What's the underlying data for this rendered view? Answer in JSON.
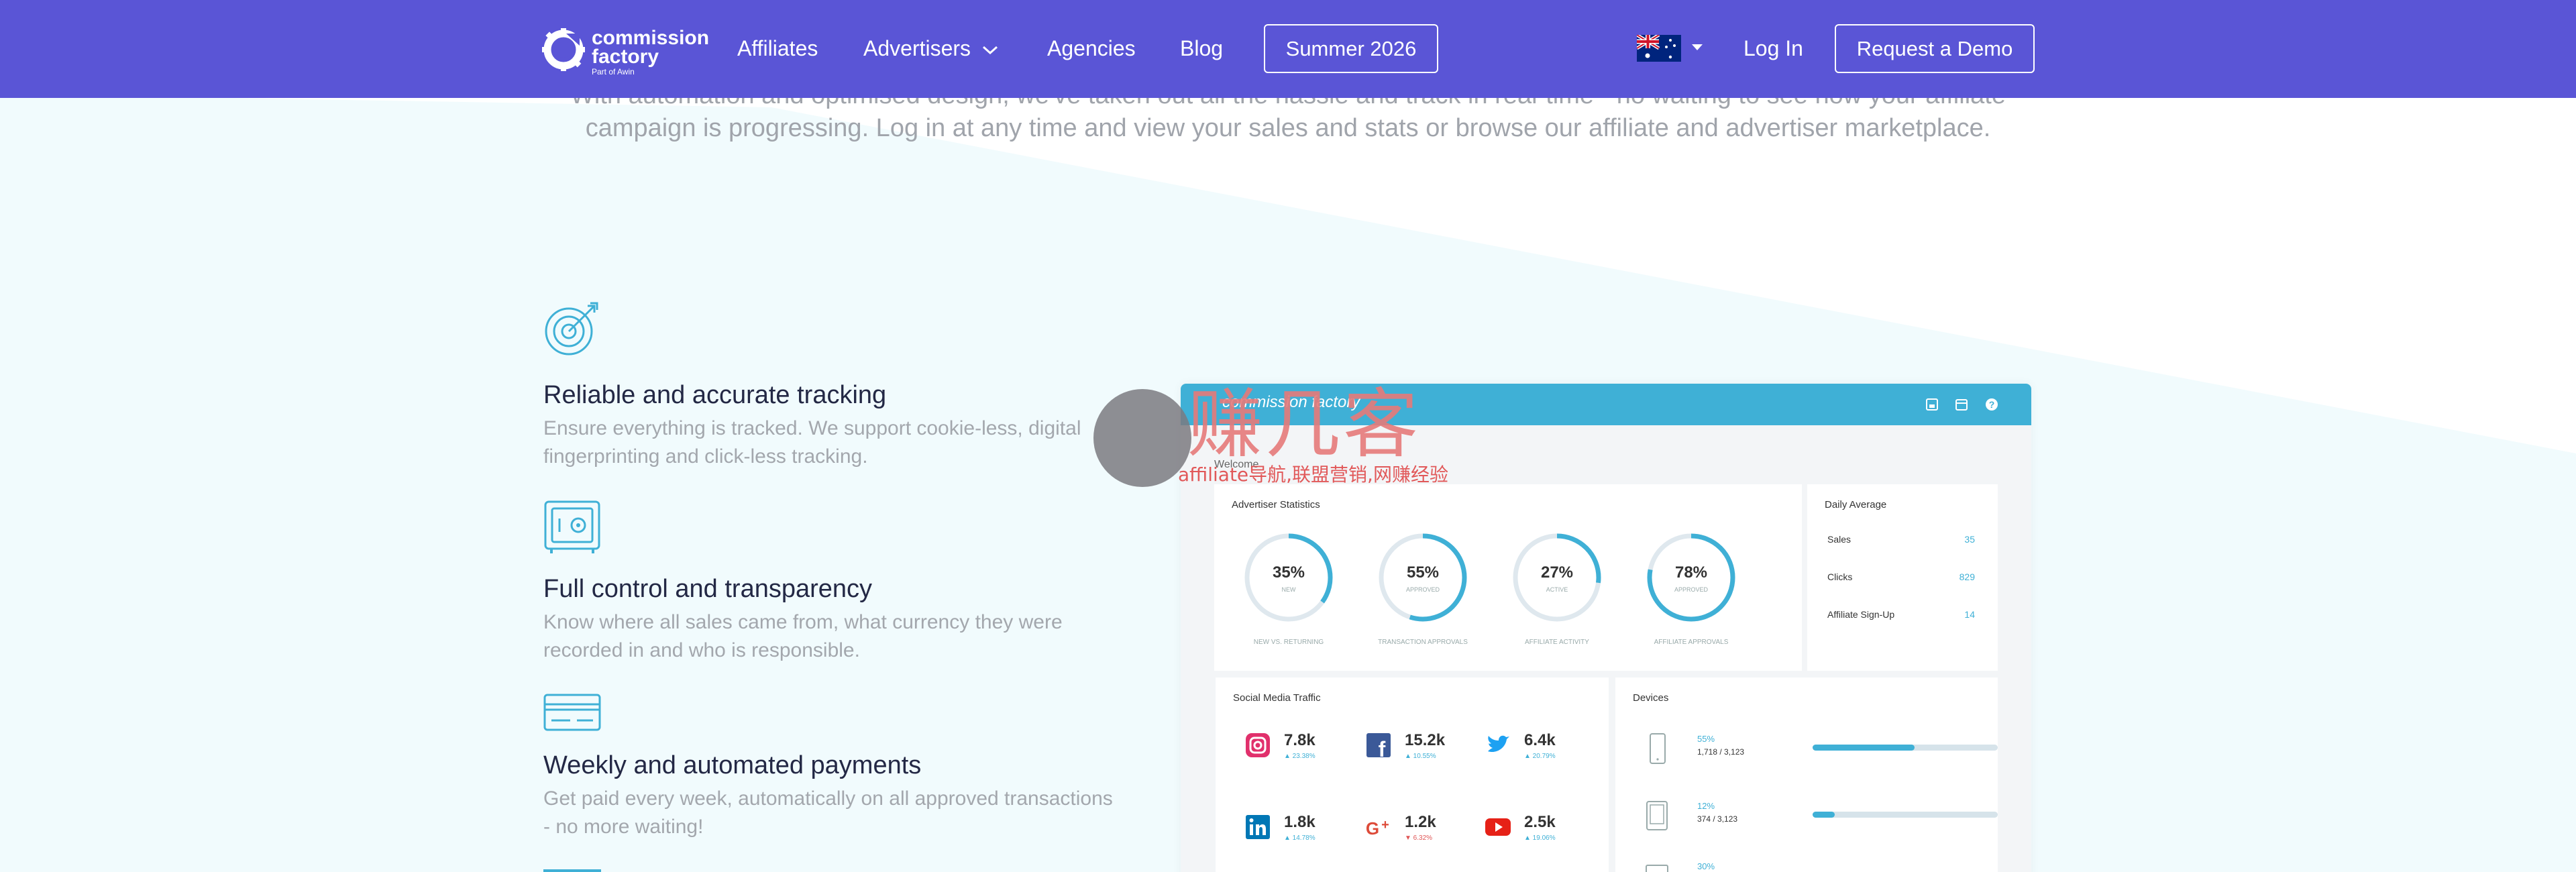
{
  "nav": {
    "logo_line1": "commission",
    "logo_line2": "factory",
    "logo_sub": "Part of Awin",
    "affiliates": "Affiliates",
    "advertisers": "Advertisers",
    "agencies": "Agencies",
    "blog": "Blog",
    "summer": "Summer 2026",
    "login": "Log In",
    "demo": "Request a Demo",
    "flag": "australia-flag"
  },
  "intro": {
    "text": "With automation and optimised design, we've taken out all the hassle and track in real-time - no waiting to see how your affiliate campaign is progressing. Log in at any time and view your sales and stats or browse our affiliate and advertiser marketplace."
  },
  "features": [
    {
      "icon": "target-icon",
      "title": "Reliable and accurate tracking",
      "text": "Ensure everything is tracked. We support cookie-less, digital fingerprinting and click-less tracking."
    },
    {
      "icon": "safe-icon",
      "title": "Full control and transparency",
      "text": "Know where all sales came from, what currency they were recorded in and who is responsible."
    },
    {
      "icon": "credit-card-icon",
      "title": "Weekly and automated payments",
      "text": "Get paid every week, automatically on all approved transactions - no more waiting!"
    }
  ],
  "dashboard": {
    "brand": "commission factory",
    "welcome": "Welcome",
    "stats_title": "Advertiser Statistics",
    "stats": [
      {
        "value": "35%",
        "sub": "NEW",
        "caption": "NEW VS. RETURNING",
        "pct": 35
      },
      {
        "value": "55%",
        "sub": "APPROVED",
        "caption": "TRANSACTION APPROVALS",
        "pct": 55
      },
      {
        "value": "27%",
        "sub": "ACTIVE",
        "caption": "AFFILIATE ACTIVITY",
        "pct": 27
      },
      {
        "value": "78%",
        "sub": "APPROVED",
        "caption": "AFFILIATE APPROVALS",
        "pct": 78
      }
    ],
    "avg_title": "Daily Average",
    "avg": [
      {
        "label": "Sales",
        "value": "35"
      },
      {
        "label": "Clicks",
        "value": "829"
      },
      {
        "label": "Affiliate Sign-Up",
        "value": "14"
      }
    ],
    "social_title": "Social Media Traffic",
    "social": [
      {
        "icon": "instagram-icon",
        "value": "7.8k",
        "delta": "▲ 23.38%",
        "neg": false
      },
      {
        "icon": "facebook-icon",
        "value": "15.2k",
        "delta": "▲ 10.55%",
        "neg": false
      },
      {
        "icon": "twitter-icon",
        "value": "6.4k",
        "delta": "▲ 20.79%",
        "neg": false
      },
      {
        "icon": "linkedin-icon",
        "value": "1.8k",
        "delta": "▲ 14.78%",
        "neg": false
      },
      {
        "icon": "google-plus-icon",
        "value": "1.2k",
        "delta": "▼ 6.32%",
        "neg": true
      },
      {
        "icon": "youtube-icon",
        "value": "2.5k",
        "delta": "▲ 19.06%",
        "neg": false
      }
    ],
    "devices_title": "Devices",
    "devices": [
      {
        "icon": "phone-icon",
        "pct": "55%",
        "counts": "1,718 /  3,123",
        "fill": 0.55
      },
      {
        "icon": "tablet-icon",
        "pct": "12%",
        "counts": "374 /  3,123",
        "fill": 0.12
      },
      {
        "icon": "desktop-icon",
        "pct": "30%",
        "counts": "",
        "fill": 0.3
      }
    ]
  },
  "watermark": {
    "big": "赚几客",
    "small": "affiliate导航,联盟营销,网赚经验"
  },
  "colors": {
    "nav": "#5a55d6",
    "accent": "#3fb0d6",
    "muted": "#a3a7ad"
  }
}
